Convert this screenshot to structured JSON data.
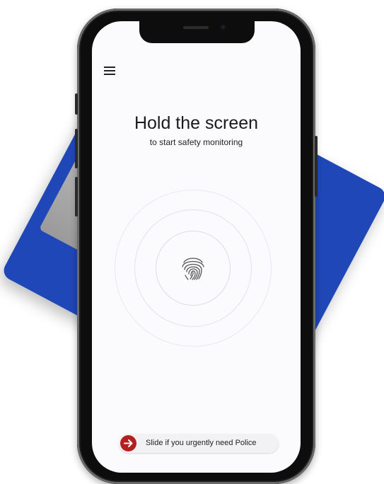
{
  "header": {
    "title": "Hold the screen",
    "subtitle": "to start safety monitoring"
  },
  "slider": {
    "label": "Slide if you urgently need Police"
  },
  "colors": {
    "accent": "#b3201f",
    "device_blue": "#1f47b8",
    "screen_bg": "#fbfbfd"
  },
  "icons": {
    "menu": "menu-icon",
    "fingerprint": "fingerprint-icon",
    "arrow": "arrow-right-icon"
  }
}
